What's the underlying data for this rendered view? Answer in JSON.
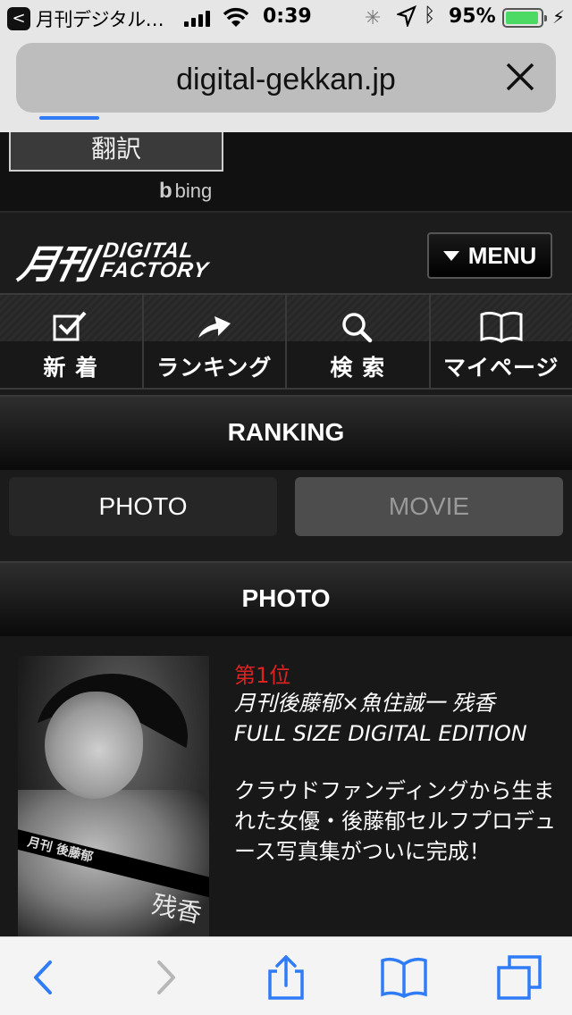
{
  "status_bar": {
    "back_app": "月刊デジタル…",
    "time": "0:39",
    "battery_percent": "95%",
    "battery_level": 0.95
  },
  "browser": {
    "url": "digital-gekkan.jp",
    "load_progress": 0.12
  },
  "translate": {
    "button_label": "翻訳",
    "powered_by": "bing"
  },
  "header": {
    "logo_kanji": "月刊",
    "logo_line1": "DIGITAL",
    "logo_line2": "FACTORY",
    "menu_label": "MENU"
  },
  "nav": {
    "items": [
      {
        "label": "新 着",
        "icon": "check-icon"
      },
      {
        "label": "ランキング",
        "icon": "arrow-icon"
      },
      {
        "label": "検 索",
        "icon": "search-icon"
      },
      {
        "label": "マイページ",
        "icon": "book-icon"
      }
    ]
  },
  "ranking": {
    "section_title": "RANKING",
    "tabs": [
      {
        "label": "PHOTO",
        "active": true
      },
      {
        "label": "MOVIE",
        "active": false
      }
    ],
    "list_title": "PHOTO",
    "items": [
      {
        "rank": "第1位",
        "title_line1": "月刊後藤郁×魚住誠一 残香",
        "title_line2": "FULL SIZE DIGITAL EDITION",
        "description": "クラウドファンディングから生まれた女優・後藤郁セルフプロデュース写真集がついに完成！",
        "thumb_banner": "月刊 後藤郁",
        "thumb_caption": "残香"
      }
    ]
  },
  "toolbar": {
    "icons": [
      "back-icon",
      "forward-icon",
      "share-icon",
      "bookmarks-icon",
      "tabs-icon"
    ]
  }
}
